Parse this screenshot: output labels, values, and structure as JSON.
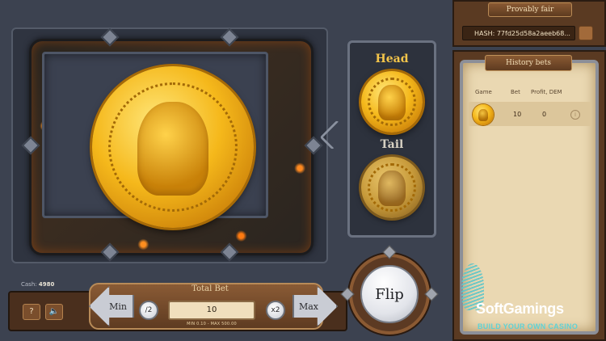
{
  "provably_fair": {
    "title": "Provably fair",
    "hash": "HASH: 77fd25d58a2aeeb68..."
  },
  "history": {
    "title": "History bets",
    "columns": [
      "Game",
      "Bet",
      "Profit, DEM"
    ],
    "rows": [
      {
        "game_icon": "coin-head-icon",
        "bet": "10",
        "profit": "0",
        "info": "i"
      }
    ]
  },
  "selector": {
    "head_label": "Head",
    "tail_label": "Tail",
    "selected": "Head"
  },
  "cash": {
    "label": "Cash:",
    "value": "4980"
  },
  "controls": {
    "help_label": "?",
    "sound_icon": "speaker-icon",
    "total_bet_label": "Total Bet",
    "min_label": "Min",
    "half_label": "/2",
    "bet_value": "10",
    "double_label": "x2",
    "max_label": "Max",
    "limits": "MIN 0.10 - MAX 500.00",
    "flip_label": "Flip"
  },
  "watermark": {
    "name": "SoftGamings",
    "tagline": "BUILD YOUR OWN CASINO"
  },
  "colors": {
    "gold": "#f5b81b",
    "lava": "#ff7a10",
    "panel": "#3b4150",
    "wood": "#5a3a22",
    "parchment": "#ead8b2",
    "teal": "#5fd2d6"
  }
}
